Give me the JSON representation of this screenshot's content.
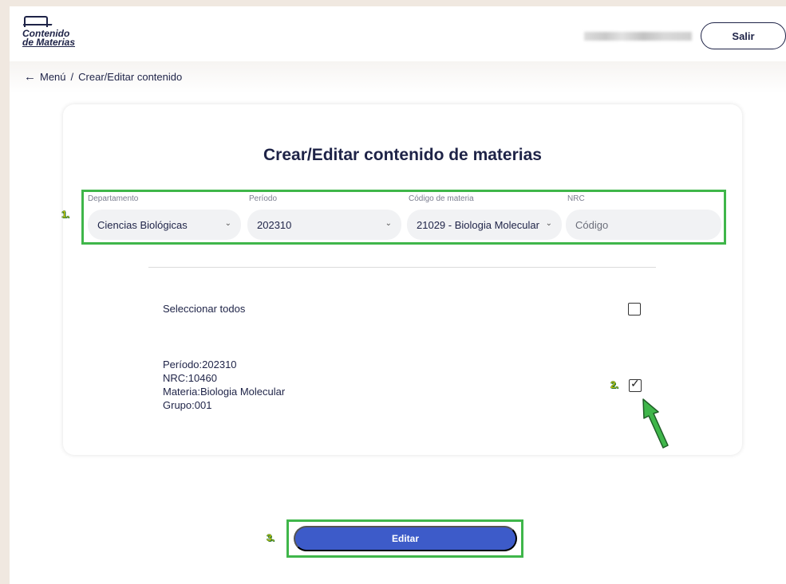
{
  "header": {
    "logo_line1": "Contenido",
    "logo_line2": "de Materias",
    "logout_label": "Salir"
  },
  "breadcrumb": {
    "back_label": "Menú",
    "separator": "/",
    "current": "Crear/Editar contenido"
  },
  "page": {
    "title": "Crear/Editar contenido de materias"
  },
  "filters": {
    "department": {
      "label": "Departamento",
      "value": "Ciencias Biológicas"
    },
    "period": {
      "label": "Período",
      "value": "202310"
    },
    "subject_code": {
      "label": "Código de materia",
      "value": "21029 - Biologia Molecular"
    },
    "nrc": {
      "label": "NRC",
      "placeholder": "Código"
    }
  },
  "selection": {
    "select_all_label": "Seleccionar todos",
    "select_all_checked": false
  },
  "course": {
    "period": "Período:202310",
    "nrc": "NRC:10460",
    "subject": "Materia:Biologia Molecular",
    "group": "Grupo:001",
    "checked": true
  },
  "actions": {
    "edit_label": "Editar"
  },
  "annotations": {
    "step1": "1.",
    "step2": "2.",
    "step3": "3."
  },
  "colors": {
    "primary": "#3d5bc9",
    "text": "#1e2347",
    "highlight": "#3fb64a",
    "page_bg": "#f0e8e0"
  }
}
